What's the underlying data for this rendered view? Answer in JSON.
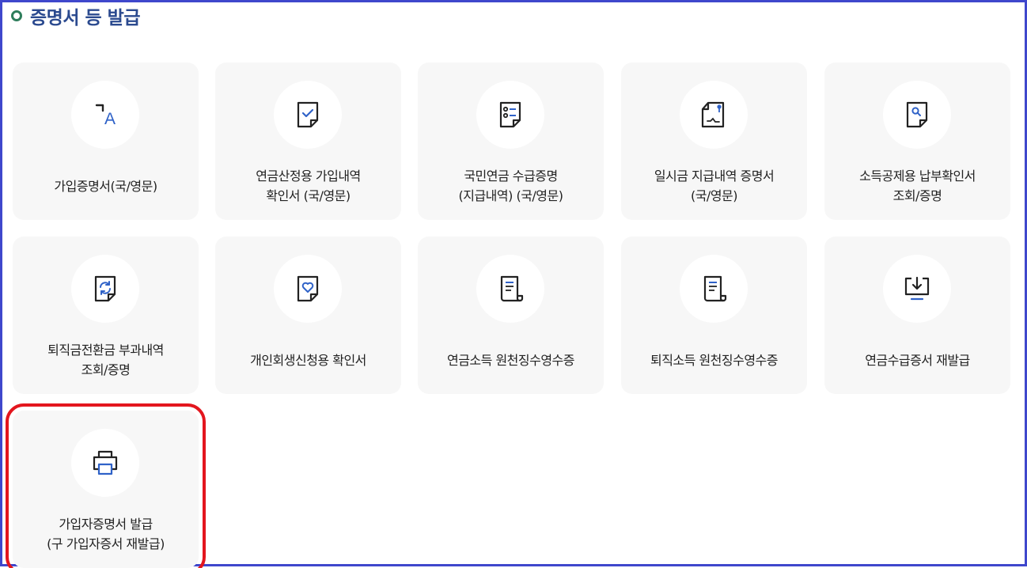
{
  "section": {
    "title": "증명서 등 발급"
  },
  "colors": {
    "accent": "#3f47cc",
    "title": "#2b4a8f",
    "highlight": "#e3161e",
    "icon_blue": "#2f62c8"
  },
  "cards": [
    {
      "label": "가입증명서(국/영문)",
      "icon": "language-icon"
    },
    {
      "label": "연금산정용 가입내역\n확인서 (국/영문)",
      "icon": "document-check-icon"
    },
    {
      "label": "국민연금 수급증명\n(지급내역) (국/영문)",
      "icon": "document-list-icon"
    },
    {
      "label": "일시금 지급내역 증명서\n(국/영문)",
      "icon": "document-signature-icon"
    },
    {
      "label": "소득공제용 납부확인서\n조회/증명",
      "icon": "document-search-icon"
    },
    {
      "label": "퇴직금전환금 부과내역\n조회/증명",
      "icon": "document-refresh-icon"
    },
    {
      "label": "개인회생신청용 확인서",
      "icon": "document-heart-icon"
    },
    {
      "label": "연금소득 원천징수영수증",
      "icon": "receipt-scroll-icon"
    },
    {
      "label": "퇴직소득 원천징수영수증",
      "icon": "receipt-scroll-icon"
    },
    {
      "label": "연금수급증서 재발급",
      "icon": "monitor-download-icon"
    },
    {
      "label": "가입자증명서 발급\n(구 가입자증서 재발급)",
      "icon": "printer-icon"
    }
  ]
}
